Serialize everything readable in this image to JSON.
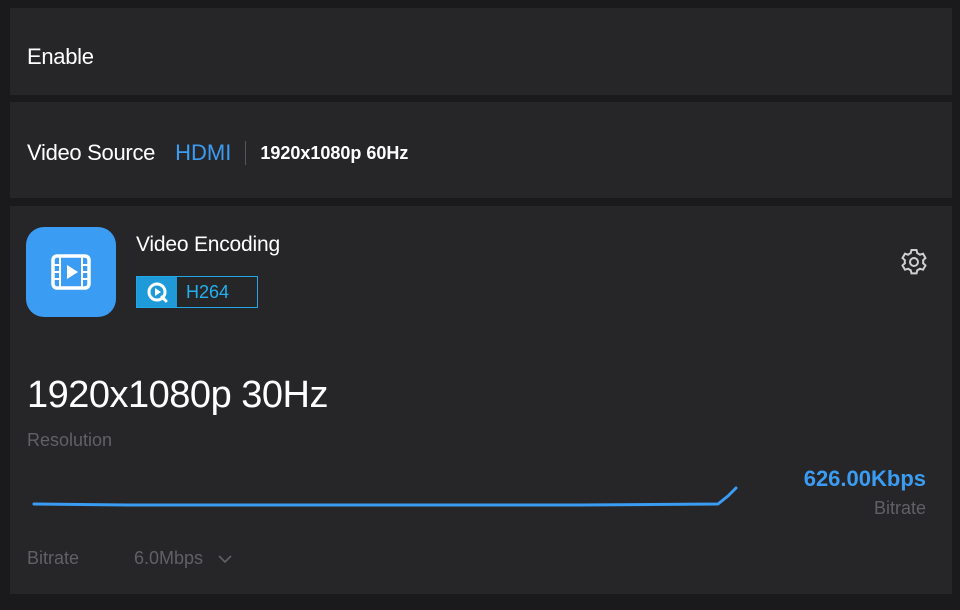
{
  "enable": {
    "label": "Enable"
  },
  "video_source": {
    "label": "Video Source",
    "value": "HDMI",
    "detail": "1920x1080p 60Hz"
  },
  "video_encoding": {
    "title": "Video Encoding",
    "icon": "film-play-icon",
    "codec": {
      "icon": "codec-play-icon",
      "name": "H264"
    },
    "settings_icon": "gear-icon",
    "resolution": {
      "value": "1920x1080p 30Hz",
      "label": "Resolution"
    },
    "bitrate_live": {
      "value": "626.00Kbps",
      "label": "Bitrate"
    },
    "bitrate_setting": {
      "label": "Bitrate",
      "value": "6.0Mbps",
      "dropdown_icon": "chevron-down-icon"
    }
  },
  "colors": {
    "background": "#1a1a1c",
    "panel": "#262629",
    "accent": "#3a9cf2",
    "codec_accent": "#23a6e6",
    "muted_text": "#606066"
  }
}
